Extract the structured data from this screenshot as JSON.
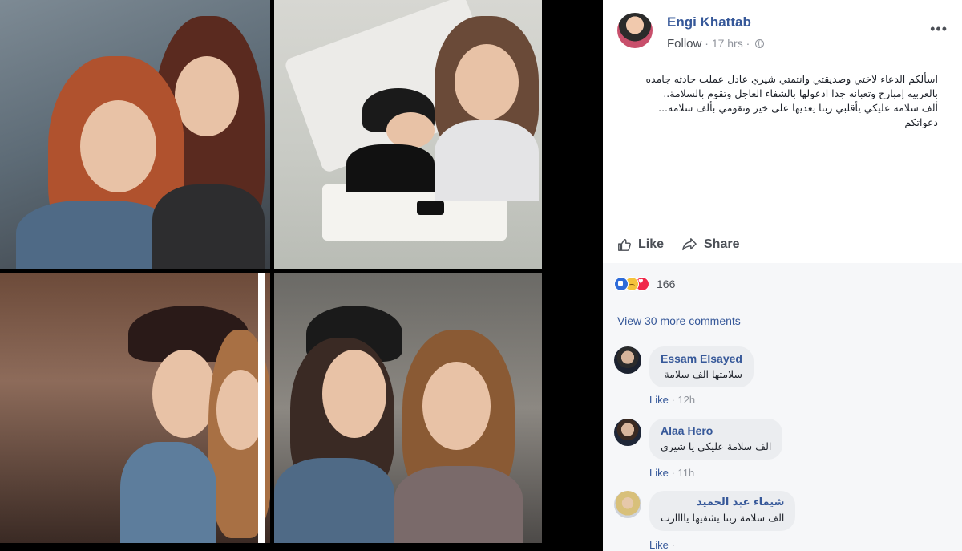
{
  "post": {
    "author": "Engi Khattab",
    "follow_label": "Follow",
    "separator": "·",
    "time": "17 hrs",
    "more_label": "•••",
    "text_lines": [
      "اسألكم الدعاء لاختي وصديقتي وانتمتي شيري عادل عملت حادثه جامده",
      "بالعربيه إمبارح وتعبانه جدا ادعولها بالشفاء العاجل وتقوم بالسلامة..",
      "ألف سلامه عليكي يأقلبي ربنا يعديها على خير وتقومي بألف سلامه...",
      "دعواتكم"
    ]
  },
  "actions": {
    "like_label": "Like",
    "share_label": "Share"
  },
  "reactions": {
    "count": "166"
  },
  "comments_section": {
    "view_more_label": "View 30 more comments",
    "comments": [
      {
        "name": "Essam Elsayed",
        "text": "سلامتها الف سلامة",
        "like_label": "Like",
        "separator": "·",
        "time": "12h"
      },
      {
        "name": "Alaa Hero",
        "text": "الف سلامة عليكي يا شيري",
        "like_label": "Like",
        "separator": "·",
        "time": "11h"
      },
      {
        "name": "شيماء عبد الحميد",
        "text": "الف سلامة ربنا يشفيها ياااارب",
        "like_label": "Like",
        "separator": "·",
        "time": ""
      }
    ]
  },
  "colors": {
    "link_blue": "#365899",
    "meta_gray": "#90949c",
    "bubble_gray": "#ebedf0",
    "like_reaction": "#2e6bd9",
    "sad_reaction": "#f5c33b",
    "love_reaction": "#f0284a"
  },
  "icons": [
    "globe-icon",
    "more-icon",
    "thumbs-up-icon",
    "share-icon",
    "like-reaction-icon",
    "sad-reaction-icon",
    "love-reaction-icon"
  ]
}
